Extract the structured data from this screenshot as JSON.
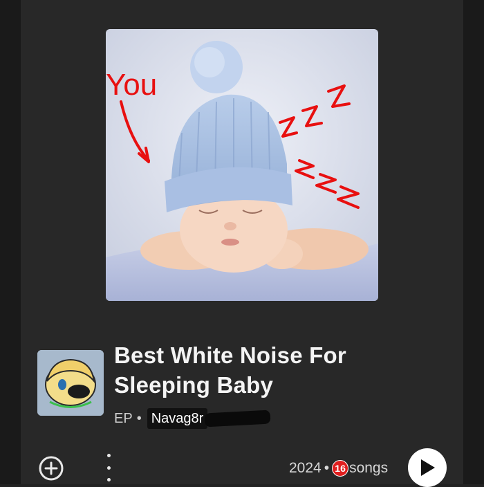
{
  "album": {
    "title": "Best White Noise For Sleeping Baby",
    "title_line1": "Best White Noise For",
    "title_line2": "Sleeping Baby",
    "type": "EP",
    "separator": "•",
    "artist": "Navag8r",
    "year": "2024",
    "song_count": "16",
    "songs_label": "songs"
  },
  "cover": {
    "annotations": {
      "you_text": "You",
      "zzz_1": "zzz",
      "zzz_2": "zzz"
    },
    "annotation_color": "#e81010"
  },
  "icons": {
    "add": "add-circle-icon",
    "more": "more-vertical-icon",
    "play": "play-icon"
  },
  "colors": {
    "background": "#282828",
    "text_primary": "#f4f4f4",
    "badge_red": "#e01e1e"
  }
}
